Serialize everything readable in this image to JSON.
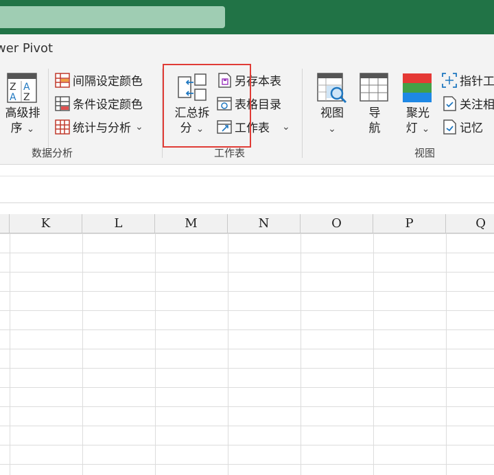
{
  "window": {
    "tab_partial": "wer Pivot"
  },
  "ribbon": {
    "groups": {
      "data_analysis": {
        "label": "数据分析",
        "advanced_sort": {
          "line1": "高级排",
          "line2": "序"
        },
        "items": [
          "间隔设定颜色",
          "条件设定颜色",
          "统计与分析"
        ]
      },
      "worksheet": {
        "label": "工作表",
        "summary_split": {
          "line1": "汇总拆",
          "line2": "分"
        },
        "items": [
          "另存本表",
          "表格目录",
          "工作表"
        ]
      },
      "view": {
        "label": "视图",
        "view_button": "视图",
        "nav_button": {
          "line1": "导",
          "line2": "航"
        },
        "spotlight_button": {
          "line1": "聚光",
          "line2": "灯"
        },
        "items": [
          "指针工",
          "关注相",
          "记忆"
        ]
      }
    }
  },
  "sheet": {
    "columns": [
      "K",
      "L",
      "M",
      "N",
      "O",
      "P",
      "Q"
    ]
  },
  "colors": {
    "title_bar": "#217346",
    "highlight_box": "#e03b35"
  },
  "icons": [
    "advanced-sort-icon",
    "interval-color-icon",
    "condition-color-icon",
    "statistics-icon",
    "summary-split-icon",
    "save-sheet-icon",
    "sheet-directory-icon",
    "worksheet-icon",
    "view-icon",
    "navigation-icon",
    "spotlight-icon",
    "pointer-tool-icon",
    "follow-icon",
    "memory-icon"
  ]
}
